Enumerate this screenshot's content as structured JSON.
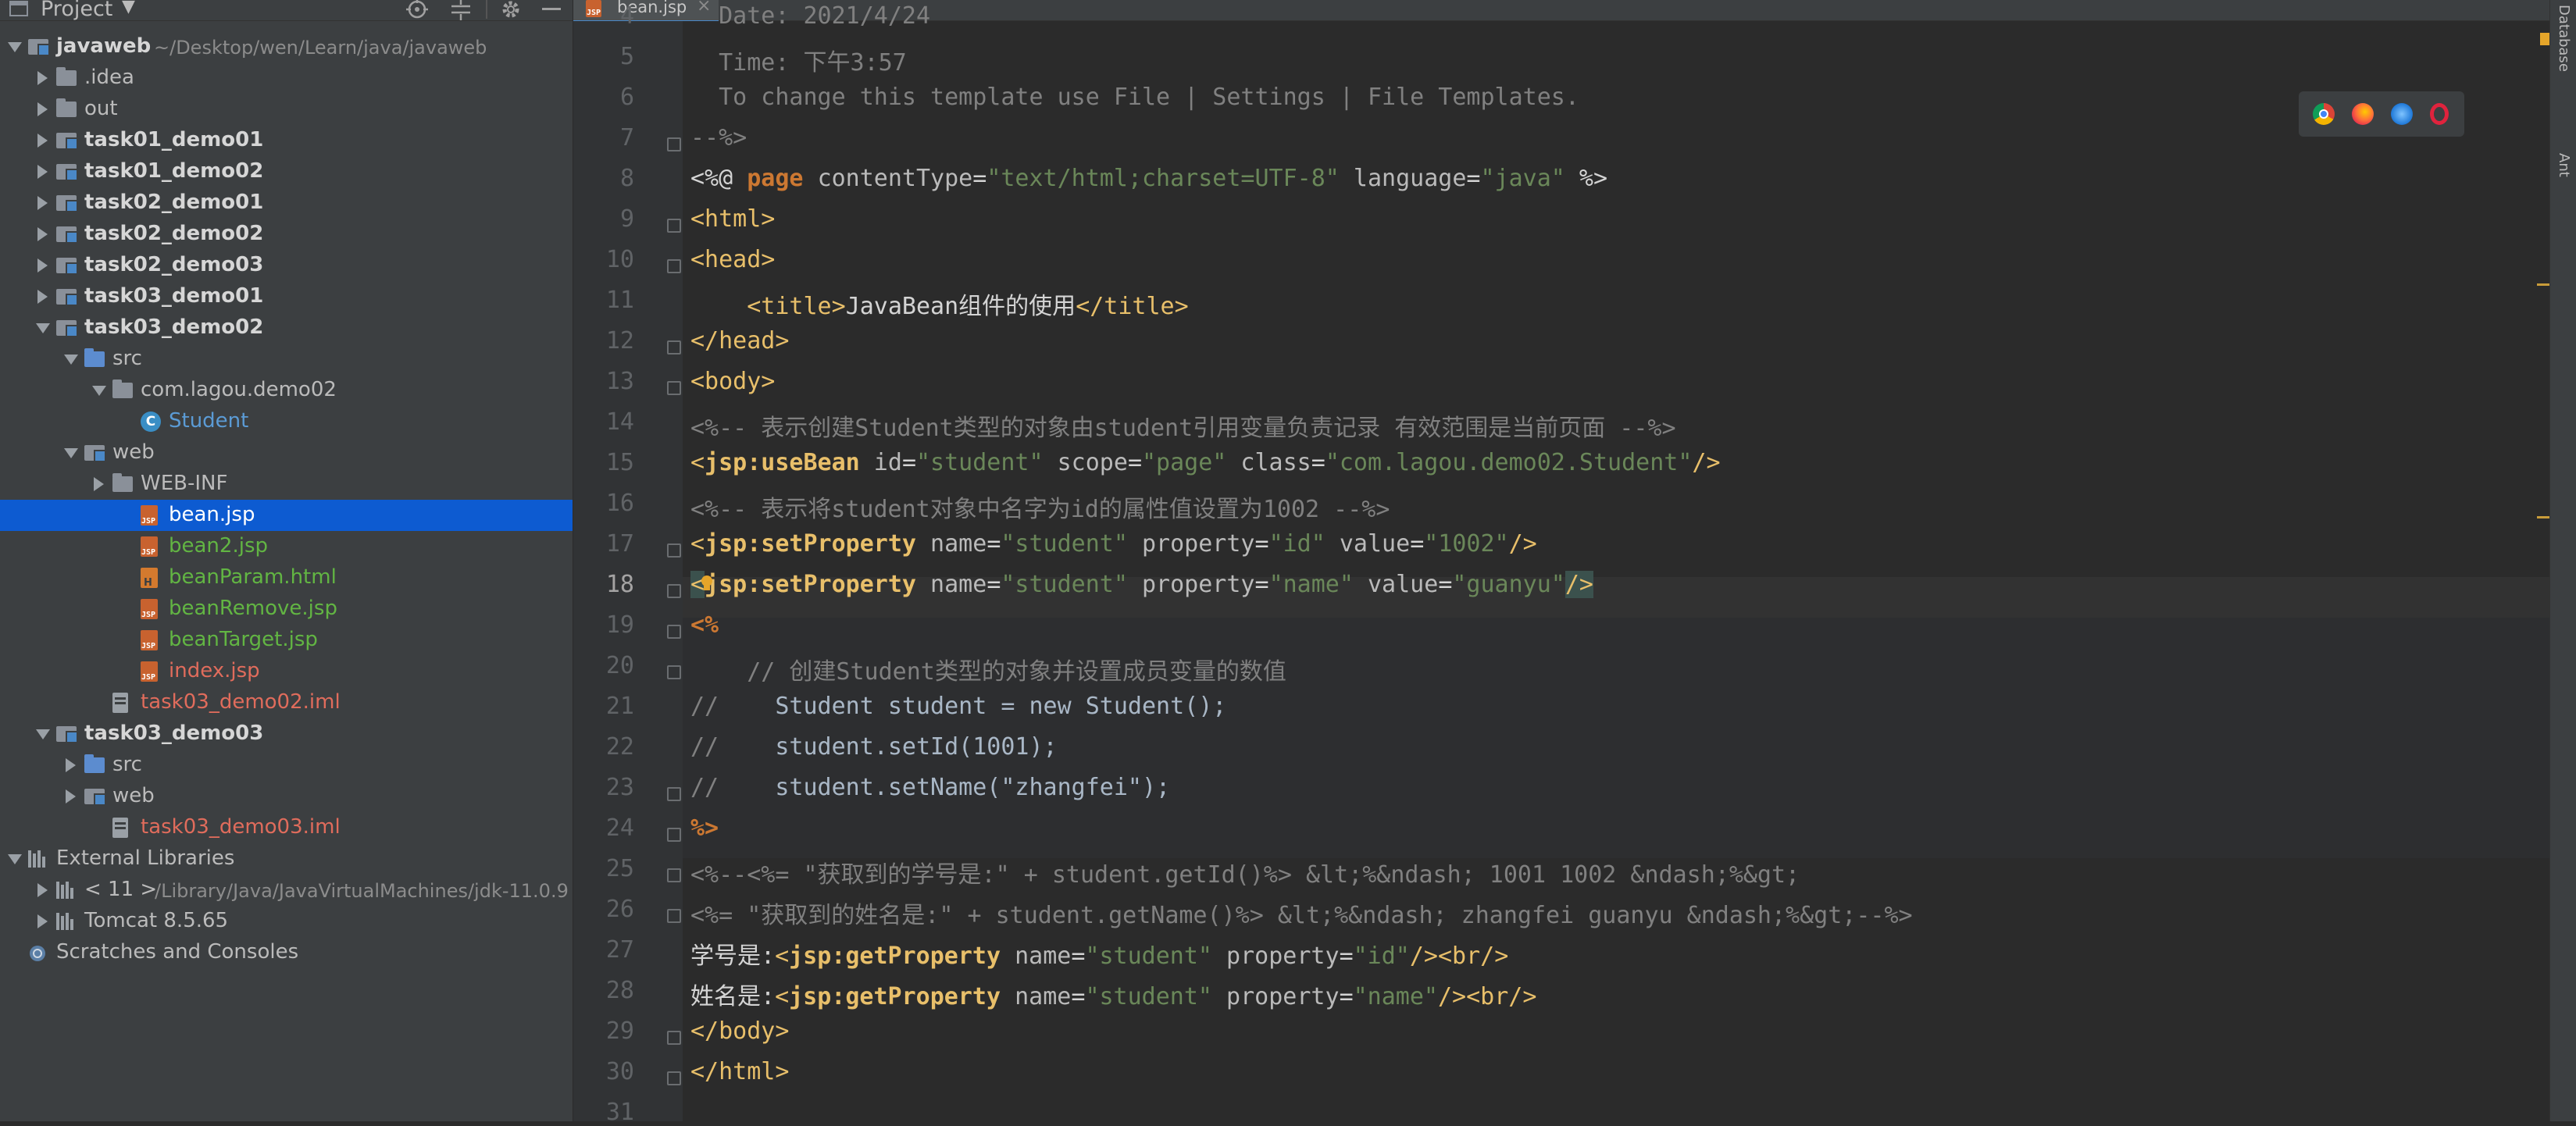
{
  "project_panel": {
    "title": "Project",
    "dropdown": "▼",
    "header_icons": [
      "target-icon",
      "collapse-icon",
      "gear-icon",
      "minimize-icon"
    ]
  },
  "tree": [
    {
      "label": "javaweb",
      "path": "~/Desktop/wen/Learn/java/javaweb",
      "indent": 0,
      "arrow": "open",
      "icon": "module-folder",
      "style": "bold"
    },
    {
      "label": ".idea",
      "indent": 1,
      "arrow": "closed",
      "icon": "folder",
      "style": "normal"
    },
    {
      "label": "out",
      "indent": 1,
      "arrow": "closed",
      "icon": "folder",
      "style": "normal"
    },
    {
      "label": "task01_demo01",
      "indent": 1,
      "arrow": "closed",
      "icon": "module-folder",
      "style": "bold"
    },
    {
      "label": "task01_demo02",
      "indent": 1,
      "arrow": "closed",
      "icon": "module-folder",
      "style": "bold"
    },
    {
      "label": "task02_demo01",
      "indent": 1,
      "arrow": "closed",
      "icon": "module-folder",
      "style": "bold"
    },
    {
      "label": "task02_demo02",
      "indent": 1,
      "arrow": "closed",
      "icon": "module-folder",
      "style": "bold"
    },
    {
      "label": "task02_demo03",
      "indent": 1,
      "arrow": "closed",
      "icon": "module-folder",
      "style": "bold"
    },
    {
      "label": "task03_demo01",
      "indent": 1,
      "arrow": "closed",
      "icon": "module-folder",
      "style": "bold"
    },
    {
      "label": "task03_demo02",
      "indent": 1,
      "arrow": "open",
      "icon": "module-folder",
      "style": "bold"
    },
    {
      "label": "src",
      "indent": 2,
      "arrow": "open",
      "icon": "src-folder",
      "style": "normal"
    },
    {
      "label": "com.lagou.demo02",
      "indent": 3,
      "arrow": "open",
      "icon": "package",
      "style": "normal"
    },
    {
      "label": "Student",
      "indent": 4,
      "arrow": "none",
      "icon": "class",
      "style": "blue"
    },
    {
      "label": "web",
      "indent": 2,
      "arrow": "open",
      "icon": "web-folder",
      "style": "normal"
    },
    {
      "label": "WEB-INF",
      "indent": 3,
      "arrow": "closed",
      "icon": "folder",
      "style": "normal"
    },
    {
      "label": "bean.jsp",
      "indent": 4,
      "arrow": "none",
      "icon": "jsp",
      "style": "white",
      "selected": true
    },
    {
      "label": "bean2.jsp",
      "indent": 4,
      "arrow": "none",
      "icon": "jsp",
      "style": "green"
    },
    {
      "label": "beanParam.html",
      "indent": 4,
      "arrow": "none",
      "icon": "html",
      "style": "green"
    },
    {
      "label": "beanRemove.jsp",
      "indent": 4,
      "arrow": "none",
      "icon": "jsp",
      "style": "green"
    },
    {
      "label": "beanTarget.jsp",
      "indent": 4,
      "arrow": "none",
      "icon": "jsp",
      "style": "green"
    },
    {
      "label": "index.jsp",
      "indent": 4,
      "arrow": "none",
      "icon": "jsp",
      "style": "red"
    },
    {
      "label": "task03_demo02.iml",
      "indent": 3,
      "arrow": "none",
      "icon": "iml",
      "style": "red"
    },
    {
      "label": "task03_demo03",
      "indent": 1,
      "arrow": "open",
      "icon": "module-folder",
      "style": "bold"
    },
    {
      "label": "src",
      "indent": 2,
      "arrow": "closed",
      "icon": "src-folder",
      "style": "normal"
    },
    {
      "label": "web",
      "indent": 2,
      "arrow": "closed",
      "icon": "web-folder",
      "style": "normal"
    },
    {
      "label": "task03_demo03.iml",
      "indent": 3,
      "arrow": "none",
      "icon": "iml",
      "style": "red"
    },
    {
      "label": "External Libraries",
      "indent": 0,
      "arrow": "open",
      "icon": "library",
      "style": "normal"
    },
    {
      "label": "< 11 >",
      "path": "/Library/Java/JavaVirtualMachines/jdk-11.0.9",
      "indent": 1,
      "arrow": "closed",
      "icon": "jdk",
      "style": "normal"
    },
    {
      "label": "Tomcat 8.5.65",
      "indent": 1,
      "arrow": "closed",
      "icon": "library",
      "style": "normal"
    },
    {
      "label": "Scratches and Consoles",
      "indent": 0,
      "arrow": "none",
      "icon": "scratch",
      "style": "normal"
    }
  ],
  "tab": {
    "label": "bean.jsp",
    "close": "×"
  },
  "editor": {
    "current_line": "18",
    "lines": [
      {
        "n": "4",
        "tokens": [
          [
            "c",
            "  Date: 2021/4/24"
          ]
        ]
      },
      {
        "n": "5",
        "tokens": [
          [
            "c",
            "  Time: 下午3:57"
          ]
        ]
      },
      {
        "n": "6",
        "tokens": [
          [
            "c",
            "  To change this template use File | Settings | File Templates."
          ]
        ]
      },
      {
        "n": "7",
        "tokens": [
          [
            "c",
            "--%>"
          ]
        ]
      },
      {
        "n": "8",
        "tokens": [
          [
            "w",
            "<%@ "
          ],
          [
            "k",
            "page "
          ],
          [
            "a",
            "contentType"
          ],
          [
            "w",
            "="
          ],
          [
            "s",
            "\"text/html;charset=UTF-8\""
          ],
          [
            "a",
            " language"
          ],
          [
            "w",
            "="
          ],
          [
            "s",
            "\"java\""
          ],
          [
            "w",
            " %>"
          ]
        ]
      },
      {
        "n": "9",
        "tokens": [
          [
            "t",
            "<html>"
          ]
        ]
      },
      {
        "n": "10",
        "tokens": [
          [
            "t",
            "<head>"
          ]
        ]
      },
      {
        "n": "11",
        "tokens": [
          [
            "p",
            "    "
          ],
          [
            "t",
            "<title>"
          ],
          [
            "w",
            "JavaBean组件的使用"
          ],
          [
            "t",
            "</title>"
          ]
        ]
      },
      {
        "n": "12",
        "tokens": [
          [
            "t",
            "</head>"
          ]
        ]
      },
      {
        "n": "13",
        "tokens": [
          [
            "t",
            "<body>"
          ]
        ]
      },
      {
        "n": "14",
        "tokens": [
          [
            "c",
            "<%-- 表示创建Student类型的对象由student引用变量负责记录 有效范围是当前页面 --%>"
          ]
        ]
      },
      {
        "n": "15",
        "tokens": [
          [
            "t",
            "<"
          ],
          [
            "j",
            "jsp:useBean"
          ],
          [
            "a",
            " id"
          ],
          [
            "w",
            "="
          ],
          [
            "s",
            "\"student\""
          ],
          [
            "a",
            " scope"
          ],
          [
            "w",
            "="
          ],
          [
            "s",
            "\"page\""
          ],
          [
            "a",
            " class"
          ],
          [
            "w",
            "="
          ],
          [
            "s",
            "\"com.lagou.demo02.Student\""
          ],
          [
            "t",
            "/>"
          ]
        ]
      },
      {
        "n": "16",
        "tokens": [
          [
            "c",
            "<%-- 表示将student对象中名字为id的属性值设置为1002 --%>"
          ]
        ]
      },
      {
        "n": "17",
        "tokens": [
          [
            "t",
            "<"
          ],
          [
            "j",
            "jsp:setProperty"
          ],
          [
            "a",
            " name"
          ],
          [
            "w",
            "="
          ],
          [
            "s",
            "\"student\""
          ],
          [
            "a",
            " property"
          ],
          [
            "w",
            "="
          ],
          [
            "s",
            "\"id\""
          ],
          [
            "a",
            " value"
          ],
          [
            "w",
            "="
          ],
          [
            "s",
            "\"1002\""
          ],
          [
            "t",
            "/>"
          ]
        ]
      },
      {
        "n": "18",
        "tokens": [
          [
            "h",
            "<"
          ],
          [
            "j",
            "jsp:setProperty"
          ],
          [
            "a",
            " name"
          ],
          [
            "w",
            "="
          ],
          [
            "s",
            "\"student\""
          ],
          [
            "a",
            " property"
          ],
          [
            "w",
            "="
          ],
          [
            "s",
            "\"name\""
          ],
          [
            "a",
            " value"
          ],
          [
            "w",
            "="
          ],
          [
            "s",
            "\"guanyu\""
          ],
          [
            "h",
            "/>"
          ]
        ]
      },
      {
        "n": "19",
        "tokens": [
          [
            "k",
            "<%"
          ]
        ]
      },
      {
        "n": "20",
        "tokens": [
          [
            "c",
            "    // 创建Student类型的对象并设置成员变量的数值"
          ]
        ]
      },
      {
        "n": "21",
        "tokens": [
          [
            "c",
            "//    "
          ],
          [
            "p",
            "Student student = new Student();"
          ]
        ]
      },
      {
        "n": "22",
        "tokens": [
          [
            "c",
            "//    "
          ],
          [
            "p",
            "student.setId(1001);"
          ]
        ]
      },
      {
        "n": "23",
        "tokens": [
          [
            "c",
            "//    "
          ],
          [
            "p",
            "student.setName(\"zhangfei\");"
          ]
        ]
      },
      {
        "n": "24",
        "tokens": [
          [
            "k",
            "%>"
          ]
        ]
      },
      {
        "n": "25",
        "tokens": [
          [
            "c",
            "<%--<%= \"获取到的学号是:\" + student.getId()%> &lt;%&ndash; 1001 1002 &ndash;%&gt;"
          ]
        ]
      },
      {
        "n": "26",
        "tokens": [
          [
            "c",
            "<%= \"获取到的姓名是:\" + student.getName()%> &lt;%&ndash; zhangfei guanyu &ndash;%&gt;--%>"
          ]
        ]
      },
      {
        "n": "27",
        "tokens": [
          [
            "w",
            "学号是:"
          ],
          [
            "t",
            "<"
          ],
          [
            "j",
            "jsp:getProperty"
          ],
          [
            "a",
            " name"
          ],
          [
            "w",
            "="
          ],
          [
            "s",
            "\"student\""
          ],
          [
            "a",
            " property"
          ],
          [
            "w",
            "="
          ],
          [
            "s",
            "\"id\""
          ],
          [
            "t",
            "/><br/>"
          ]
        ]
      },
      {
        "n": "28",
        "tokens": [
          [
            "w",
            "姓名是:"
          ],
          [
            "t",
            "<"
          ],
          [
            "j",
            "jsp:getProperty"
          ],
          [
            "a",
            " name"
          ],
          [
            "w",
            "="
          ],
          [
            "s",
            "\"student\""
          ],
          [
            "a",
            " property"
          ],
          [
            "w",
            "="
          ],
          [
            "s",
            "\"name\""
          ],
          [
            "t",
            "/><br/>"
          ]
        ]
      },
      {
        "n": "29",
        "tokens": [
          [
            "t",
            "</body>"
          ]
        ]
      },
      {
        "n": "30",
        "tokens": [
          [
            "t",
            "</html>"
          ]
        ]
      },
      {
        "n": "31",
        "tokens": []
      }
    ]
  },
  "browser_icons": [
    "chrome-icon",
    "firefox-icon",
    "safari-icon",
    "opera-icon"
  ],
  "right_tabs": [
    "Database",
    "Ant"
  ],
  "colors": {
    "selection": "#0d5bd1",
    "tag": "#e8bf6a",
    "string": "#6a8759",
    "keyword": "#cc7832",
    "comment": "#808080"
  }
}
